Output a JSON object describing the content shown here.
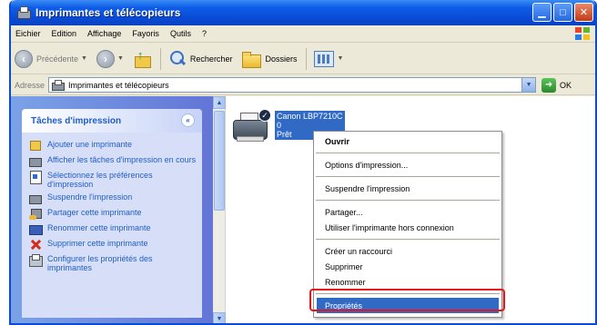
{
  "window": {
    "title": "Imprimantes et télécopieurs",
    "buttons": [
      "minimize-button",
      "maximize-button",
      "close-button"
    ]
  },
  "menubar": [
    "Eichier",
    "Edition",
    "Affichage",
    "Fayoris",
    "Qutils",
    "?"
  ],
  "toolbar": {
    "back_label": "Précédente",
    "search_label": "Rechercher",
    "folders_label": "Dossiers"
  },
  "address": {
    "label": "Adresse",
    "value": "Imprimantes et télécopieurs",
    "go_label": "OK"
  },
  "tasks": {
    "header": "Tâches d'impression",
    "items": [
      {
        "label": "Ajouter une imprimante",
        "icon": "add-printer-icon"
      },
      {
        "label": "Afficher les tâches d'impression en cours",
        "icon": "print-queue-icon"
      },
      {
        "label": "Sélectionnez les préférences d'impression",
        "icon": "preferences-icon"
      },
      {
        "label": "Suspendre l'impression",
        "icon": "pause-printing-icon"
      },
      {
        "label": "Partager cette imprimante",
        "icon": "share-printer-icon"
      },
      {
        "label": "Renommer cette imprimante",
        "icon": "rename-printer-icon"
      },
      {
        "label": "Supprimer cette imprimante",
        "icon": "delete-icon"
      },
      {
        "label": "Configurer les propriétés des imprimantes",
        "icon": "printer-properties-icon"
      }
    ]
  },
  "printer": {
    "name": "Canon LBP7210C",
    "jobs": "0",
    "status": "Prêt"
  },
  "context_menu": {
    "items": [
      {
        "label": "Ouvrir",
        "bold": true
      },
      {
        "sep": true
      },
      {
        "label": "Options d'impression..."
      },
      {
        "sep": true
      },
      {
        "label": "Suspendre l'impression"
      },
      {
        "sep": true
      },
      {
        "label": "Partager..."
      },
      {
        "label": "Utiliser l'imprimante hors connexion"
      },
      {
        "sep": true
      },
      {
        "label": "Créer un raccourci"
      },
      {
        "label": "Supprimer"
      },
      {
        "label": "Renommer"
      },
      {
        "sep": true
      },
      {
        "label": "Propriétés",
        "selected": true
      }
    ]
  },
  "colors": {
    "titlebar": "#0a4bd6",
    "selection": "#316ac5",
    "highlight_border": "#e8141a",
    "task_link": "#215dc6"
  }
}
